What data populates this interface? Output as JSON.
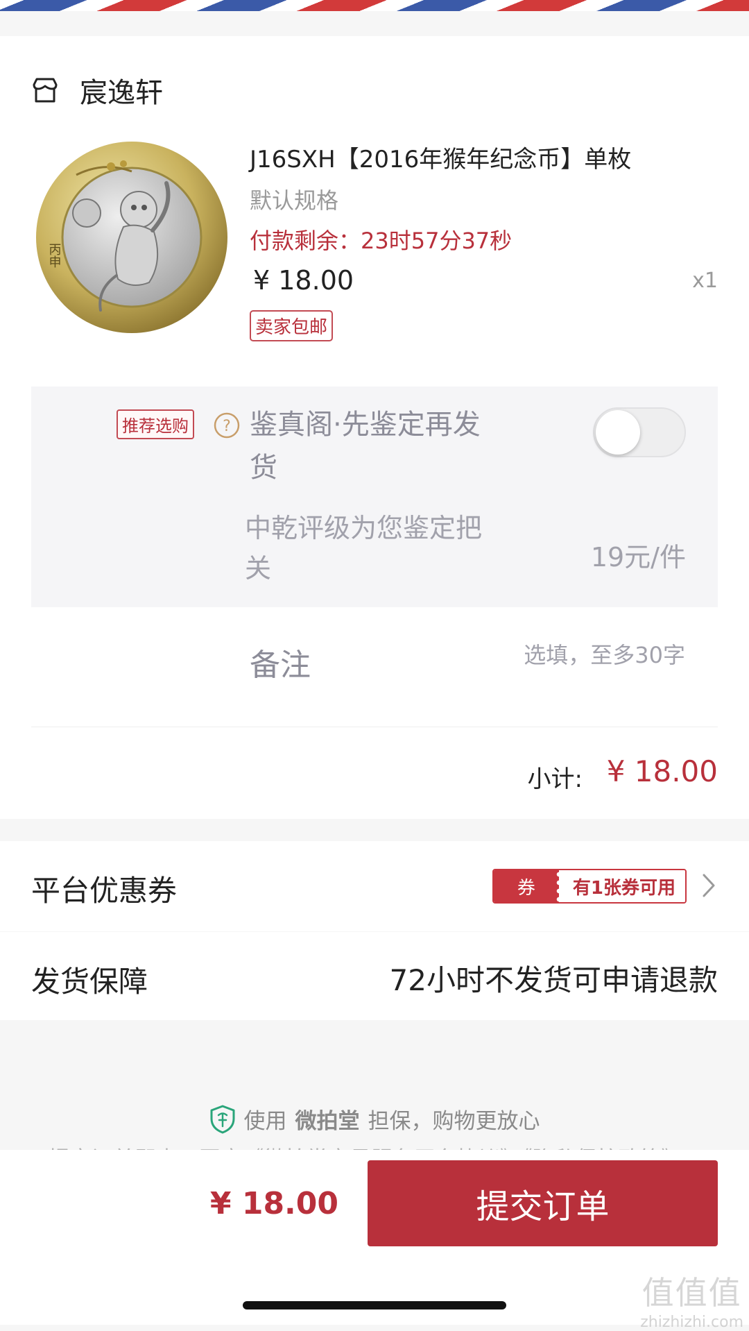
{
  "store": {
    "name": "宸逸轩"
  },
  "product": {
    "title": "J16SXH【2016年猴年纪念币】单枚",
    "spec": "默认规格",
    "countdown": "付款剩余：23时57分37秒",
    "price": "¥ 18.00",
    "quantity": "x1",
    "shipping_tag": "卖家包邮",
    "coin_inscription": "丙申"
  },
  "appraisal": {
    "recommend_tag": "推荐选购",
    "help_glyph": "?",
    "title": "鉴真阁·先鉴定再发货",
    "description": "中乾评级为您鉴定把关",
    "price": "19元/件",
    "toggle_on": false
  },
  "remark": {
    "label": "备注",
    "placeholder": "选填，至多30字",
    "value": ""
  },
  "subtotal": {
    "label": "小计:",
    "value": "¥ 18.00"
  },
  "coupon": {
    "label": "平台优惠券",
    "badge_left": "券",
    "badge_right": "有1张券可用"
  },
  "guarantee": {
    "label": "发货保障",
    "value": "72小时不发货可申请退款"
  },
  "assurance": {
    "prefix": "使用",
    "brand": "微拍堂",
    "suffix": "担保，购物更放心",
    "clipped_line": "提交订单即表示同意《微拍堂交易服务平台协议》《隐私保护政策》"
  },
  "footer": {
    "total": "¥ 18.00",
    "submit_label": "提交订单"
  },
  "watermark": {
    "glyphs": "值值值",
    "url": "zhizhizhi.com"
  },
  "colors": {
    "accent": "#b8303b",
    "background": "#f6f6f6",
    "muted": "#9a9a9a"
  }
}
